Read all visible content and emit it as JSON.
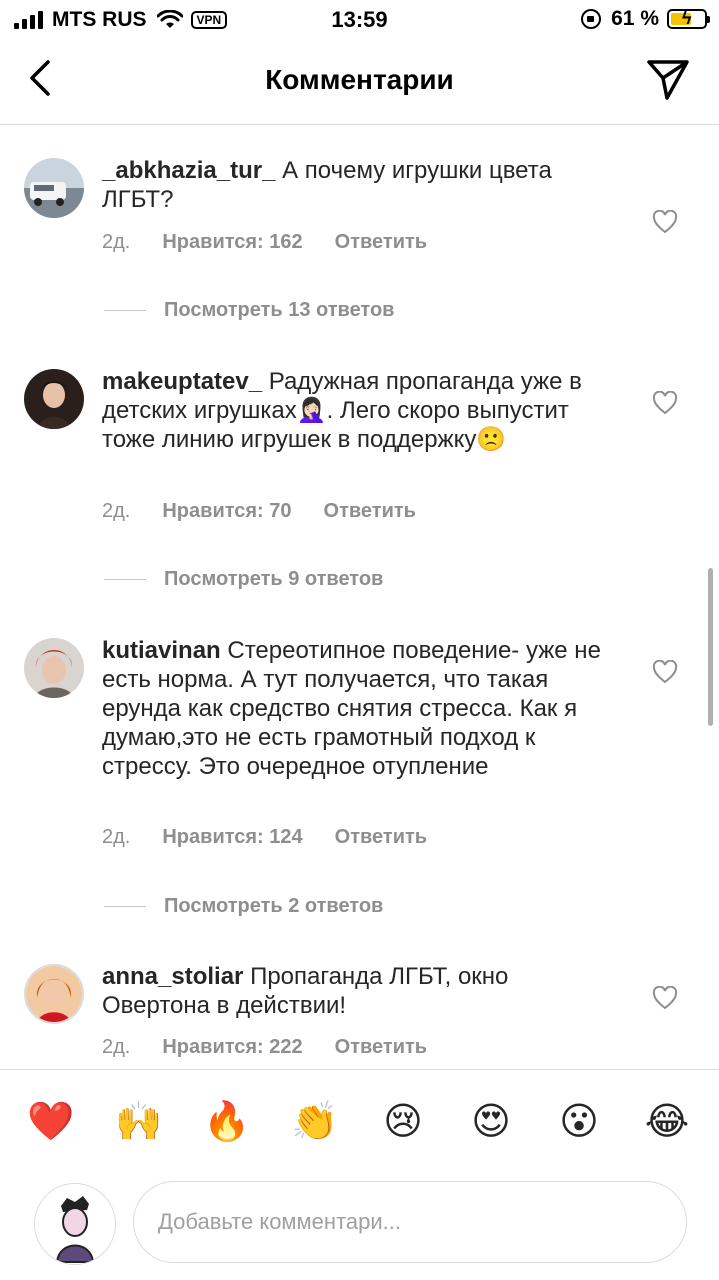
{
  "status_bar": {
    "carrier": "MTS RUS",
    "vpn": "VPN",
    "time": "13:59",
    "battery_text": "61 %",
    "battery_level": 0.61
  },
  "header": {
    "title": "Комментарии"
  },
  "comments": [
    {
      "username": "_abkhazia_tur_",
      "text": "А почему игрушки цвета ЛГБТ?",
      "time": "2д.",
      "likes": "Нравится: 162",
      "reply": "Ответить",
      "view_replies": "Посмотреть 13 ответов"
    },
    {
      "username": "makeuptatev_",
      "text": "Радужная пропаганда уже в детских игрушках🤦🏻‍♀️. Лего скоро выпустит тоже линию  игрушек в поддержку🙁",
      "time": "2д.",
      "likes": "Нравится: 70",
      "reply": "Ответить",
      "view_replies": "Посмотреть 9 ответов"
    },
    {
      "username": "kutiavinan",
      "text": "Стереотипное поведение- уже не есть норма. А тут получается, что такая ерунда как средство снятия стресса. Как я думаю,это не есть грамотный подход к стрессу. Это очередное отупление",
      "time": "2д.",
      "likes": "Нравится: 124",
      "reply": "Ответить",
      "view_replies": "Посмотреть 2 ответов"
    },
    {
      "username": "anna_stoliar",
      "text": "Пропаганда ЛГБТ, окно Овертона в действии!",
      "time": "2д.",
      "likes": "Нравится: 222",
      "reply": "Ответить"
    }
  ],
  "emoji_bar": [
    "❤️",
    "🙌",
    "🔥",
    "👏",
    "😢",
    "😍",
    "😮",
    "😂"
  ],
  "input": {
    "placeholder": "Добавьте комментари..."
  },
  "icons": {
    "back": "chevron-left-icon",
    "send": "paper-plane-icon",
    "like": "heart-outline-icon"
  },
  "colors": {
    "text": "#262626",
    "secondary": "#8e8e8e",
    "divider": "#dbdbdb"
  }
}
